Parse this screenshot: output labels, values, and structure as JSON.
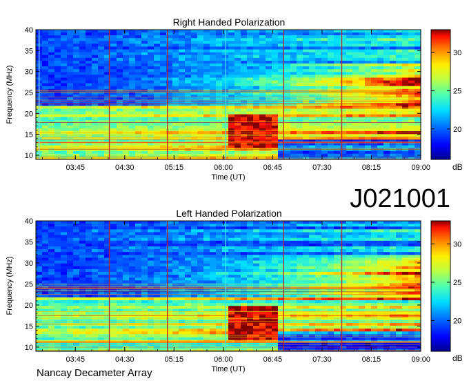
{
  "observation_id": "J021001",
  "instrument": "Nancay Decameter Array",
  "colorscale": [
    "#00008f",
    "#0000ff",
    "#0070ff",
    "#00dfff",
    "#50ffaf",
    "#bfff40",
    "#ffef00",
    "#ff8000",
    "#ff1000",
    "#800000"
  ],
  "chart_data": [
    {
      "type": "heatmap",
      "title": "Right Handed Polarization",
      "xlabel": "Time (UT)",
      "ylabel": "Frequency (MHz)",
      "x_ticks": [
        "03:45",
        "04:30",
        "05:15",
        "06:00",
        "06:45",
        "07:30",
        "08:15",
        "09:00"
      ],
      "y_ticks": [
        10,
        15,
        20,
        25,
        30,
        35,
        40
      ],
      "xlim": [
        "03:09",
        "09:00"
      ],
      "ylim": [
        9,
        40
      ],
      "colorbar": {
        "unit": "dB",
        "ticks": [
          20,
          25,
          30
        ],
        "range": [
          16,
          33
        ]
      },
      "vertical_markers": [
        {
          "time": "03:12",
          "color": "#7fd0ff"
        },
        {
          "time": "04:16",
          "color": "#c02020"
        },
        {
          "time": "05:09",
          "color": "#c02020"
        },
        {
          "time": "06:02",
          "color": "#3fe0e0"
        },
        {
          "time": "06:55",
          "color": "#c02020"
        },
        {
          "time": "07:48",
          "color": "#c02020"
        }
      ],
      "features": {
        "strong_block": {
          "t0": "06:03",
          "t1": "06:47",
          "f0": 12,
          "f1": 20
        },
        "quiet_low_band_after": {
          "t": "06:47",
          "f0": 9,
          "f1": 14
        }
      }
    },
    {
      "type": "heatmap",
      "title": "Left Handed Polarization",
      "xlabel": "Time (UT)",
      "ylabel": "Frequency (MHz)",
      "x_ticks": [
        "03:45",
        "04:30",
        "05:15",
        "06:00",
        "06:45",
        "07:30",
        "08:15",
        "09:00"
      ],
      "y_ticks": [
        10,
        15,
        20,
        25,
        30,
        35,
        40
      ],
      "xlim": [
        "03:09",
        "09:00"
      ],
      "ylim": [
        9,
        40
      ],
      "colorbar": {
        "unit": "dB",
        "ticks": [
          20,
          25,
          30
        ],
        "range": [
          16,
          33
        ]
      },
      "vertical_markers": [
        {
          "time": "04:16",
          "color": "#c02020"
        },
        {
          "time": "05:09",
          "color": "#c02020"
        },
        {
          "time": "06:02",
          "color": "#3fe0e0"
        },
        {
          "time": "06:55",
          "color": "#c02020"
        },
        {
          "time": "07:48",
          "color": "#c02020"
        }
      ],
      "features": {
        "strong_block": {
          "t0": "06:03",
          "t1": "06:47",
          "f0": 12,
          "f1": 20
        },
        "quiet_low_band_after": {
          "t": "06:47",
          "f0": 9,
          "f1": 14
        }
      }
    }
  ]
}
